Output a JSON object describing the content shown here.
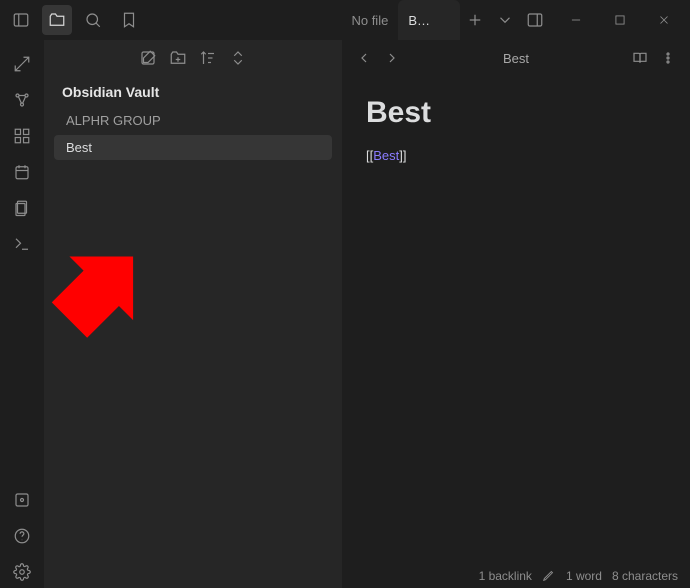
{
  "titlebar": {
    "tab_inactive": "No file",
    "tab_active": "B…"
  },
  "sidebar": {
    "vault_title": "Obsidian Vault",
    "items": [
      {
        "label": "ALPHR GROUP"
      },
      {
        "label": "Best"
      }
    ]
  },
  "editor": {
    "breadcrumb": "Best",
    "note_title": "Best",
    "link_text": "Best"
  },
  "statusbar": {
    "backlinks": "1 backlink",
    "words": "1 word",
    "chars": "8 characters"
  }
}
